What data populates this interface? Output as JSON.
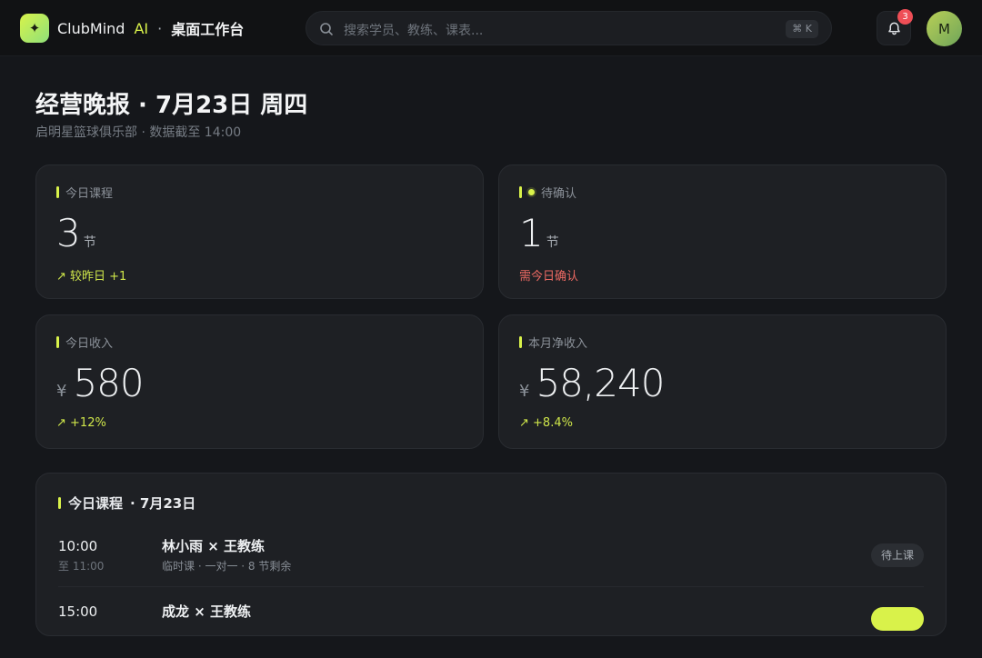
{
  "app": {
    "logo_glyph": "✦",
    "name": "ClubMind",
    "ai": "AI",
    "separator": "·",
    "workspace": "桌面工作台"
  },
  "search": {
    "placeholder": "搜索学员、教练、课表...",
    "shortcut": "⌘ K"
  },
  "notifications": {
    "count": "3"
  },
  "user": {
    "avatar_initial": "M"
  },
  "header": {
    "title": "经营晚报 · 7月23日 周四",
    "subtitle": "启明星篮球俱乐部 · 数据截至 14:00"
  },
  "stats": [
    {
      "label": "今日课程",
      "value": "3",
      "unit": "节",
      "trend": "↗ 较昨日 +1",
      "trend_type": "up"
    },
    {
      "label": "待确认",
      "value": "1",
      "unit": "节",
      "trend": "需今日确认",
      "trend_type": "warn"
    },
    {
      "label": "今日收入",
      "currency": "¥",
      "value": "580",
      "trend": "↗ +12%",
      "trend_type": "up"
    },
    {
      "label": "本月净收入",
      "currency": "¥",
      "value": "58,240",
      "trend": "↗ +8.4%",
      "trend_type": "up"
    }
  ],
  "schedule": {
    "title": "今日课程",
    "date": "· 7月23日",
    "items": [
      {
        "start": "10:00",
        "end": "至 11:00",
        "who": "林小雨 × 王教练",
        "meta": "临时课 · 一对一 · 8 节剩余",
        "status": "待上课"
      },
      {
        "start": "15:00",
        "end": "",
        "who": "成龙 × 王教练",
        "meta": "",
        "status": ""
      }
    ]
  },
  "colors": {
    "accent": "#d9f24a",
    "warn": "#ec6a63",
    "badge": "#ef4e56"
  }
}
